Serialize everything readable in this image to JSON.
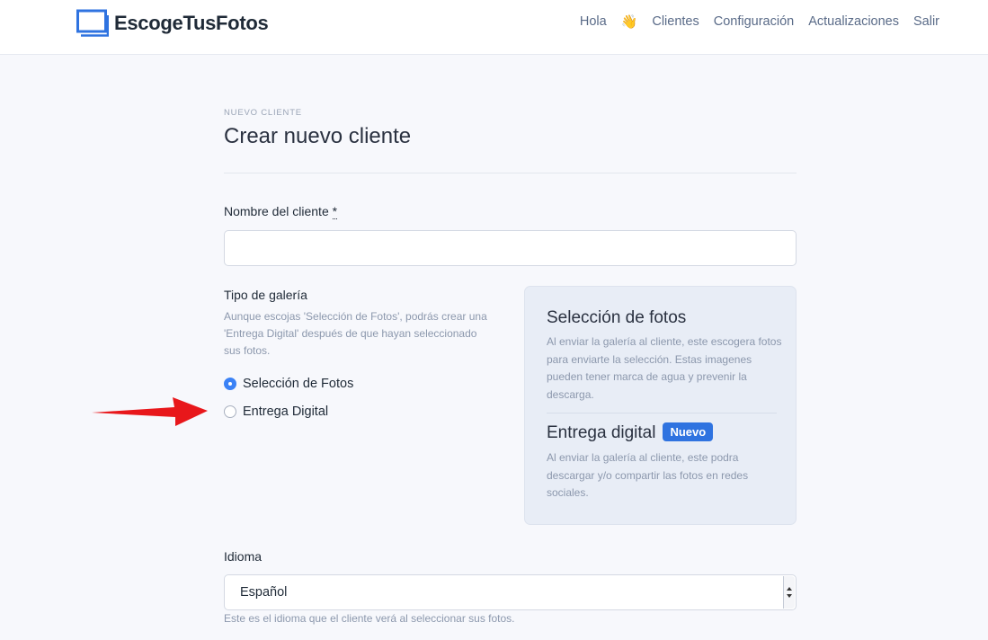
{
  "header": {
    "brand": "EscogeTusFotos",
    "nav": {
      "hello": "Hola",
      "wave": "👋",
      "clients": "Clientes",
      "settings": "Configuración",
      "updates": "Actualizaciones",
      "logout": "Salir"
    }
  },
  "page": {
    "overline": "NUEVO CLIENTE",
    "title": "Crear nuevo cliente"
  },
  "form": {
    "client_name": {
      "label": "Nombre del cliente",
      "required_mark": "*",
      "value": ""
    },
    "gallery_type": {
      "label": "Tipo de galería",
      "help": "Aunque escojas 'Selección de Fotos', podrás crear una 'Entrega Digital' después de que hayan seleccionado sus fotos.",
      "options": [
        {
          "label": "Selección de Fotos",
          "selected": true
        },
        {
          "label": "Entrega Digital",
          "selected": false
        }
      ]
    },
    "language": {
      "label": "Idioma",
      "selected": "Español",
      "help": "Este es el idioma que el cliente verá al seleccionar sus fotos."
    }
  },
  "info_card": {
    "selection_title": "Selección de fotos",
    "selection_text": "Al enviar la galería al cliente, este escogera fotos para enviarte la selección. Estas imagenes pueden tener marca de agua y prevenir la descarga.",
    "delivery_title": "Entrega digital",
    "delivery_badge": "Nuevo",
    "delivery_text": "Al enviar la galería al cliente, este podra descargar y/o compartir las fotos en redes sociales."
  },
  "colors": {
    "accent": "#3b82f6",
    "badge": "#2f73e0",
    "brand_icon": "#2f73e0",
    "arrow": "#e8171b"
  },
  "icons": [
    "brand-logo-icon",
    "waving-hand-icon",
    "red-arrow-annotation"
  ]
}
